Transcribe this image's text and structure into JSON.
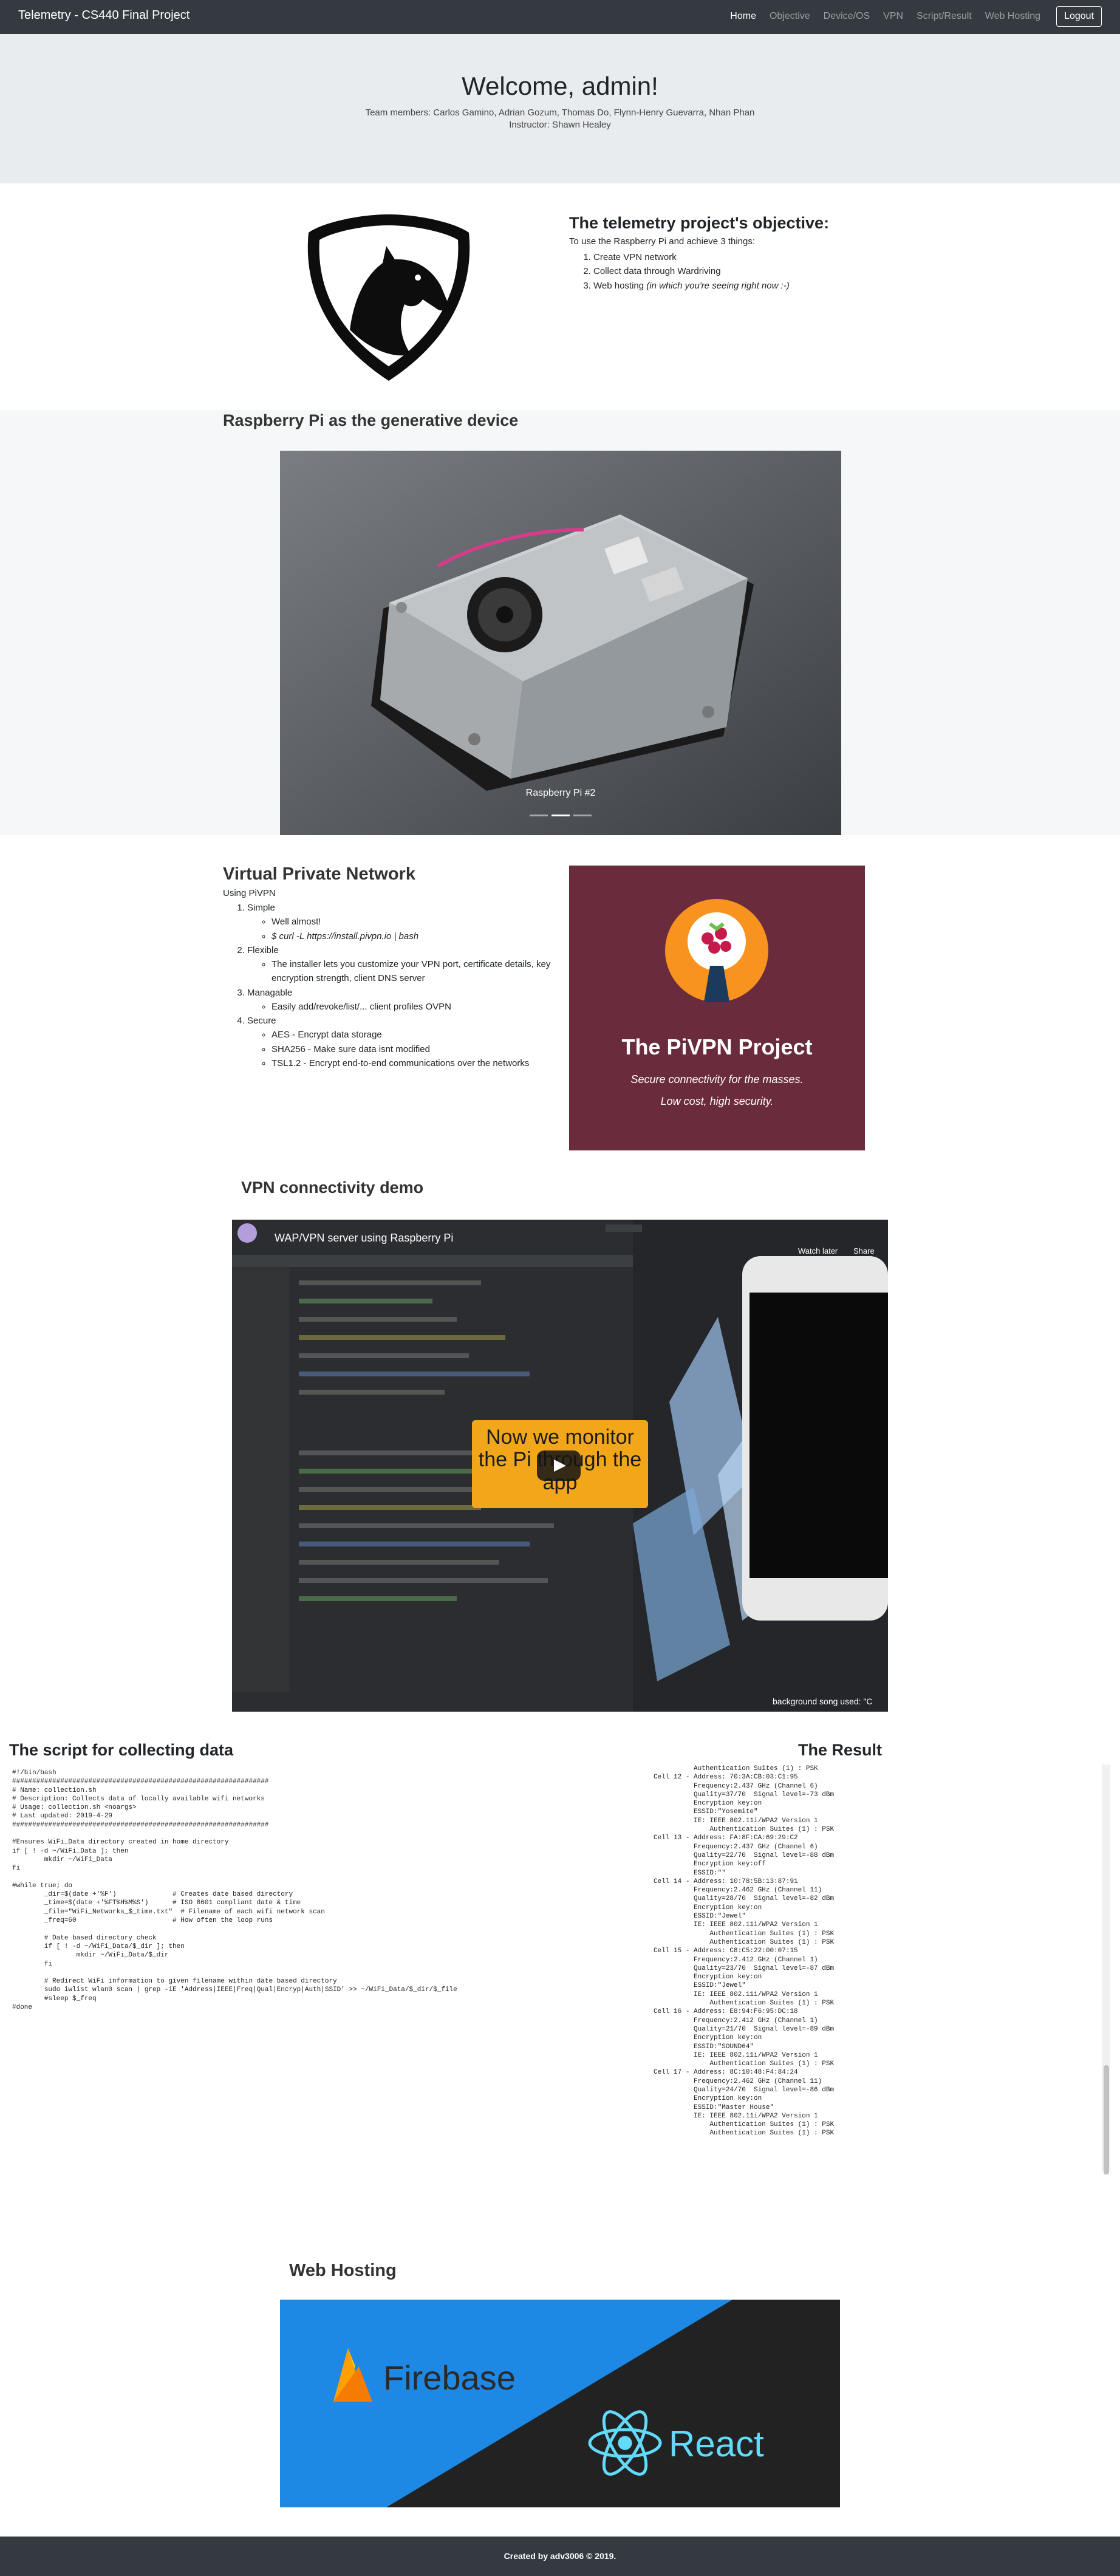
{
  "navbar": {
    "brand": "Telemetry - CS440 Final Project",
    "links": [
      "Home",
      "Objective",
      "Device/OS",
      "VPN",
      "Script/Result",
      "Web Hosting"
    ],
    "logout": "Logout"
  },
  "hero": {
    "title": "Welcome, admin!",
    "team": "Team members: Carlos Gamino, Adrian Gozum, Thomas Do, Flynn-Henry Guevarra, Nhan Phan",
    "instructor": "Instructor: Shawn Healey"
  },
  "objective": {
    "title": "The telemetry project's objective:",
    "intro": "To use the Raspberry Pi and achieve 3 things:",
    "items": [
      "Create VPN network",
      "Collect data through Wardriving",
      "Web hosting "
    ],
    "item3_note": "(in which you're seeing right now :-)"
  },
  "rpi": {
    "title": "Raspberry Pi as the generative device",
    "caption": "Raspberry Pi #2",
    "active_slide": 2,
    "slides": 3
  },
  "vpn": {
    "title": "Virtual Private Network",
    "intro": "Using PiVPN",
    "items": [
      {
        "label": "Simple",
        "subs": [
          "Well almost!",
          "$ curl -L https://install.pivpn.io | bash"
        ]
      },
      {
        "label": "Flexible",
        "subs": [
          "The installer lets you customize your VPN port, certificate details, key encryption strength, client DNS server"
        ]
      },
      {
        "label": "Managable",
        "subs": [
          "Easily add/revoke/list/... client profiles OVPN"
        ]
      },
      {
        "label": "Secure",
        "subs": [
          "AES - Encrypt data storage",
          "SHA256 - Make sure data isnt modified",
          "TSL1.2 - Encrypt end-to-end communications over the networks"
        ]
      }
    ],
    "card": {
      "title": "The PiVPN Project",
      "sub1": "Secure connectivity for the masses.",
      "sub2": "Low cost, high security."
    }
  },
  "demo": {
    "title": "VPN connectivity demo",
    "video_title": "WAP/VPN server using Raspberry Pi",
    "watch_later": "Watch later",
    "share": "Share",
    "overlay": "Now we monitor the Pi through the app",
    "background_song": "background song used: \"C"
  },
  "script": {
    "title": "The script for collecting data",
    "code": "#!/bin/bash\n################################################################\n# Name: collection.sh\n# Description: Collects data of locally available wifi networks\n# Usage: collection.sh <noargs>\n# Last updated: 2019-4-29\n################################################################\n\n#Ensures WiFi_Data directory created in home directory\nif [ ! -d ~/WiFi_Data ]; then\n        mkdir ~/WiFi_Data\nfi\n\n#while true; do\n        _dir=$(date +'%F')              # Creates date based directory\n        _time=$(date +'%FT%H%M%S')      # ISO 8601 compliant date & time\n        _file=\"WiFi_Networks_$_time.txt\"  # Filename of each wifi network scan\n        _freq=60                        # How often the loop runs\n\n        # Date based directory check\n        if [ ! -d ~/WiFi_Data/$_dir ]; then\n                mkdir ~/WiFi_Data/$_dir\n        fi\n\n        # Redirect WiFi information to given filename within date based directory\n        sudo iwlist wlan0 scan | grep -iE 'Address|IEEE|Freq|Qual|Encryp|Auth|SSID' >> ~/WiFi_Data/$_dir/$_file\n        #sleep $_freq\n#done"
  },
  "result": {
    "title": "The Result",
    "text": "                    Authentication Suites (1) : PSK\n          Cell 12 - Address: 70:3A:CB:03:C1:95\n                    Frequency:2.437 GHz (Channel 6)\n                    Quality=37/70  Signal level=-73 dBm\n                    Encryption key:on\n                    ESSID:\"Yosemite\"\n                    IE: IEEE 802.11i/WPA2 Version 1\n                        Authentication Suites (1) : PSK\n          Cell 13 - Address: FA:8F:CA:69:29:C2\n                    Frequency:2.437 GHz (Channel 6)\n                    Quality=22/70  Signal level=-88 dBm\n                    Encryption key:off\n                    ESSID:\"\"\n          Cell 14 - Address: 10:78:5B:13:87:91\n                    Frequency:2.462 GHz (Channel 11)\n                    Quality=28/70  Signal level=-82 dBm\n                    Encryption key:on\n                    ESSID:\"Jewel\"\n                    IE: IEEE 802.11i/WPA2 Version 1\n                        Authentication Suites (1) : PSK\n                        Authentication Suites (1) : PSK\n          Cell 15 - Address: C8:C5:22:00:07:15\n                    Frequency:2.412 GHz (Channel 1)\n                    Quality=23/70  Signal level=-87 dBm\n                    Encryption key:on\n                    ESSID:\"Jewel\"\n                    IE: IEEE 802.11i/WPA2 Version 1\n                        Authentication Suites (1) : PSK\n          Cell 16 - Address: E8:94:F6:95:DC:18\n                    Frequency:2.412 GHz (Channel 1)\n                    Quality=21/70  Signal level=-89 dBm\n                    Encryption key:on\n                    ESSID:\"SOUND64\"\n                    IE: IEEE 802.11i/WPA2 Version 1\n                        Authentication Suites (1) : PSK\n          Cell 17 - Address: 8C:10:48:F4:84:24\n                    Frequency:2.462 GHz (Channel 11)\n                    Quality=24/70  Signal level=-86 dBm\n                    Encryption key:on\n                    ESSID:\"Master House\"\n                    IE: IEEE 802.11i/WPA2 Version 1\n                        Authentication Suites (1) : PSK\n                        Authentication Suites (1) : PSK"
  },
  "hosting": {
    "title": "Web Hosting",
    "firebase": "Firebase",
    "react": "React"
  },
  "footer": {
    "text": "Created by adv3006 © 2019."
  },
  "colors": {
    "navbar": "#343a40",
    "hero": "#e9ecef",
    "pivpn_card": "#6a2c3c",
    "pivpn_orange": "#f7931e",
    "firebase_blue": "#1e88e5",
    "react_cyan": "#61dafb"
  }
}
